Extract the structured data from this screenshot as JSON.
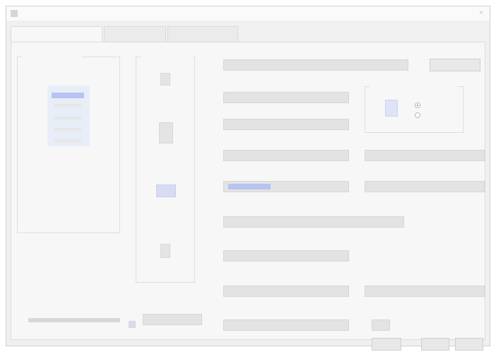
{
  "window": {
    "title": "",
    "close_glyph": "×"
  },
  "tabs": [
    {
      "label": ""
    },
    {
      "label": ""
    },
    {
      "label": ""
    }
  ],
  "left": {
    "group_label": "",
    "preview_title": "",
    "info_lines": [
      "",
      "",
      "",
      ""
    ],
    "slider_label": "",
    "bottom_label": ""
  },
  "middle": {
    "group_label": "",
    "items": [
      {
        "label": ""
      },
      {
        "label": ""
      },
      {
        "label": ""
      },
      {
        "label": ""
      }
    ],
    "bottom_label": ""
  },
  "right": {
    "name_label": "",
    "name_value": "",
    "browse_button": "",
    "fields": [
      {
        "label": "",
        "value": ""
      },
      {
        "label": "",
        "value": ""
      },
      {
        "label": "",
        "value": ""
      },
      {
        "label": "",
        "value": ""
      },
      {
        "label": "",
        "value": ""
      },
      {
        "label": "",
        "value": ""
      },
      {
        "label": "",
        "value": ""
      },
      {
        "label": "",
        "value": ""
      },
      {
        "label": "",
        "value": ""
      },
      {
        "label": "",
        "value": ""
      },
      {
        "label": "",
        "value": ""
      },
      {
        "label": "",
        "value": ""
      }
    ],
    "radio_group_label": "",
    "radio_options": [
      "",
      ""
    ]
  },
  "footer": {
    "ok": "",
    "cancel": "",
    "apply": ""
  },
  "colors": {
    "accent_blue": "#b7c3f0",
    "preview_bg": "#e8eef8"
  }
}
